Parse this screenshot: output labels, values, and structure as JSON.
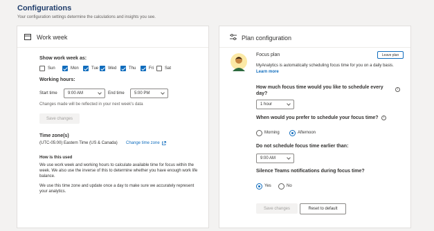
{
  "page": {
    "title": "Configurations",
    "subtitle": "Your configuration settings determine the calculations and insights you see."
  },
  "work_week": {
    "header": "Work week",
    "show_label": "Show work week as:",
    "days": [
      {
        "label": "Sun",
        "checked": false
      },
      {
        "label": "Mon",
        "checked": true
      },
      {
        "label": "Tue",
        "checked": true
      },
      {
        "label": "Wed",
        "checked": true
      },
      {
        "label": "Thu",
        "checked": true
      },
      {
        "label": "Fri",
        "checked": true
      },
      {
        "label": "Sat",
        "checked": false
      }
    ],
    "hours_label": "Working hours:",
    "start_label": "Start time",
    "start_value": "9:00 AM",
    "end_label": "End time",
    "end_value": "5:00 PM",
    "changes_note": "Changes made will be reflected in your next week's data",
    "save_label": "Save changes",
    "timezone_label": "Time zone(s)",
    "timezone_value": "(UTC-05:00) Eastern Time (US & Canada)",
    "change_tz_label": "Change time zone",
    "how_title": "How is this used",
    "how_p1": "We use work week and working hours to calculate available time for focus within the week. We also use the inverse of this to determine whether you have enough work life balance.",
    "how_p2": "We use this time zone and update once a day to make sure we accurately represent your analytics."
  },
  "plan": {
    "header": "Plan configuration",
    "focus_title": "Focus plan",
    "leave_label": "Leave plan",
    "desc": "MyAnalytics is automatically scheduling focus time for you on a daily basis.",
    "learn_more": "Learn more",
    "q1": "How much focus time would you like to schedule every day?",
    "q1_value": "1 hour",
    "q2": "When would you prefer to schedule your focus time?",
    "morning": "Morning",
    "afternoon": "Afternoon",
    "afternoon_selected": true,
    "q3": "Do not schedule focus time earlier than:",
    "q3_value": "9:00 AM",
    "q4": "Silence Teams notifications during focus time?",
    "yes": "Yes",
    "no": "No",
    "yes_selected": true,
    "save_label": "Save changes",
    "reset_label": "Reset to default"
  },
  "colors": {
    "accent": "#0f6cbd",
    "title": "#1f3d6b",
    "background": "#f3f2f1"
  }
}
